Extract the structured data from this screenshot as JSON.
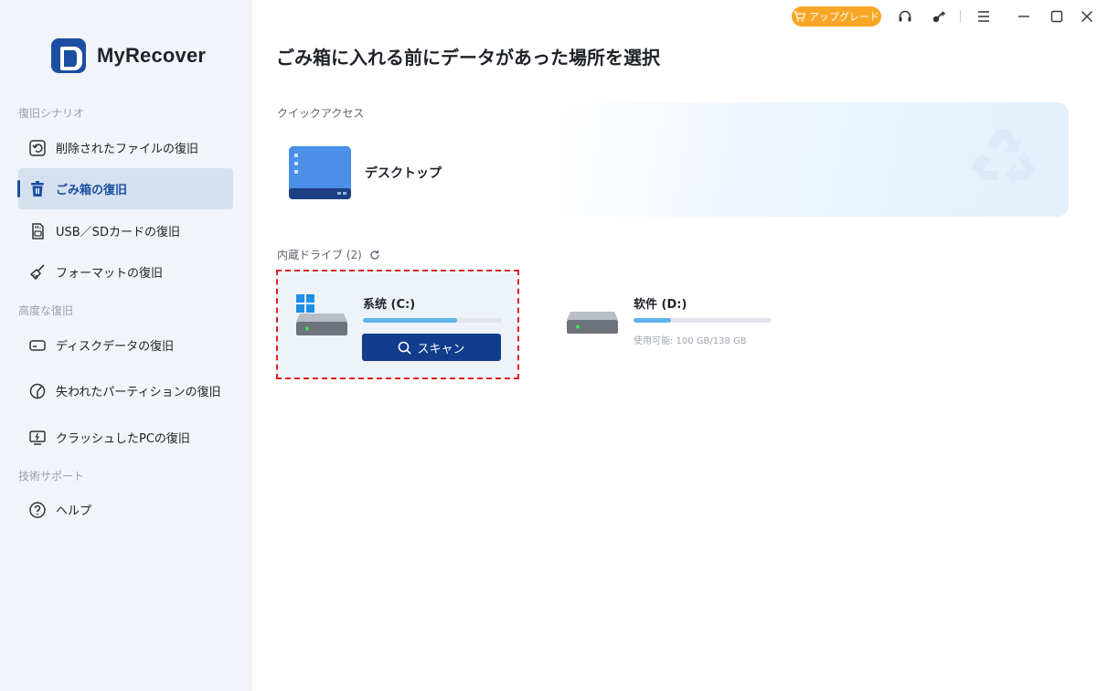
{
  "app": {
    "name": "MyRecover"
  },
  "titlebar": {
    "upgrade_label": "アップグレード"
  },
  "sidebar": {
    "sections": [
      {
        "title": "復旧シナリオ"
      },
      {
        "title": "高度な復旧"
      },
      {
        "title": "技術サポート"
      }
    ],
    "items": [
      {
        "label": "削除されたファイルの復旧",
        "icon": "restore-icon"
      },
      {
        "label": "ごみ箱の復旧",
        "icon": "trash-icon",
        "active": true
      },
      {
        "label": "USB／SDカードの復旧",
        "icon": "sd-card-icon"
      },
      {
        "label": "フォーマットの復旧",
        "icon": "broom-icon"
      },
      {
        "label": "ディスクデータの復旧",
        "icon": "disk-icon"
      },
      {
        "label": "失われたパーティションの復旧",
        "icon": "partition-icon"
      },
      {
        "label": "クラッシュしたPCの復旧",
        "icon": "crashed-pc-icon"
      },
      {
        "label": "ヘルプ",
        "icon": "help-icon"
      }
    ]
  },
  "main": {
    "title": "ごみ箱に入れる前にデータがあった場所を選択",
    "quick_access": {
      "label": "クイックアクセス",
      "desktop_label": "デスクトップ"
    },
    "drives": {
      "label": "内蔵ドライブ (2)",
      "items": [
        {
          "name": "系统 (C:)",
          "used_fraction": 0.68,
          "scan_label": "スキャン",
          "selected": true
        },
        {
          "name": "软件 (D:)",
          "used_fraction": 0.27,
          "free_text": "使用可能: 100 GB/138 GB"
        }
      ]
    }
  },
  "colors": {
    "accent": "#1c4fa1",
    "scan_button": "#123c8c",
    "upgrade": "#f7a626",
    "usage_bar": "#5fb3ea",
    "highlight": "#e02020"
  }
}
